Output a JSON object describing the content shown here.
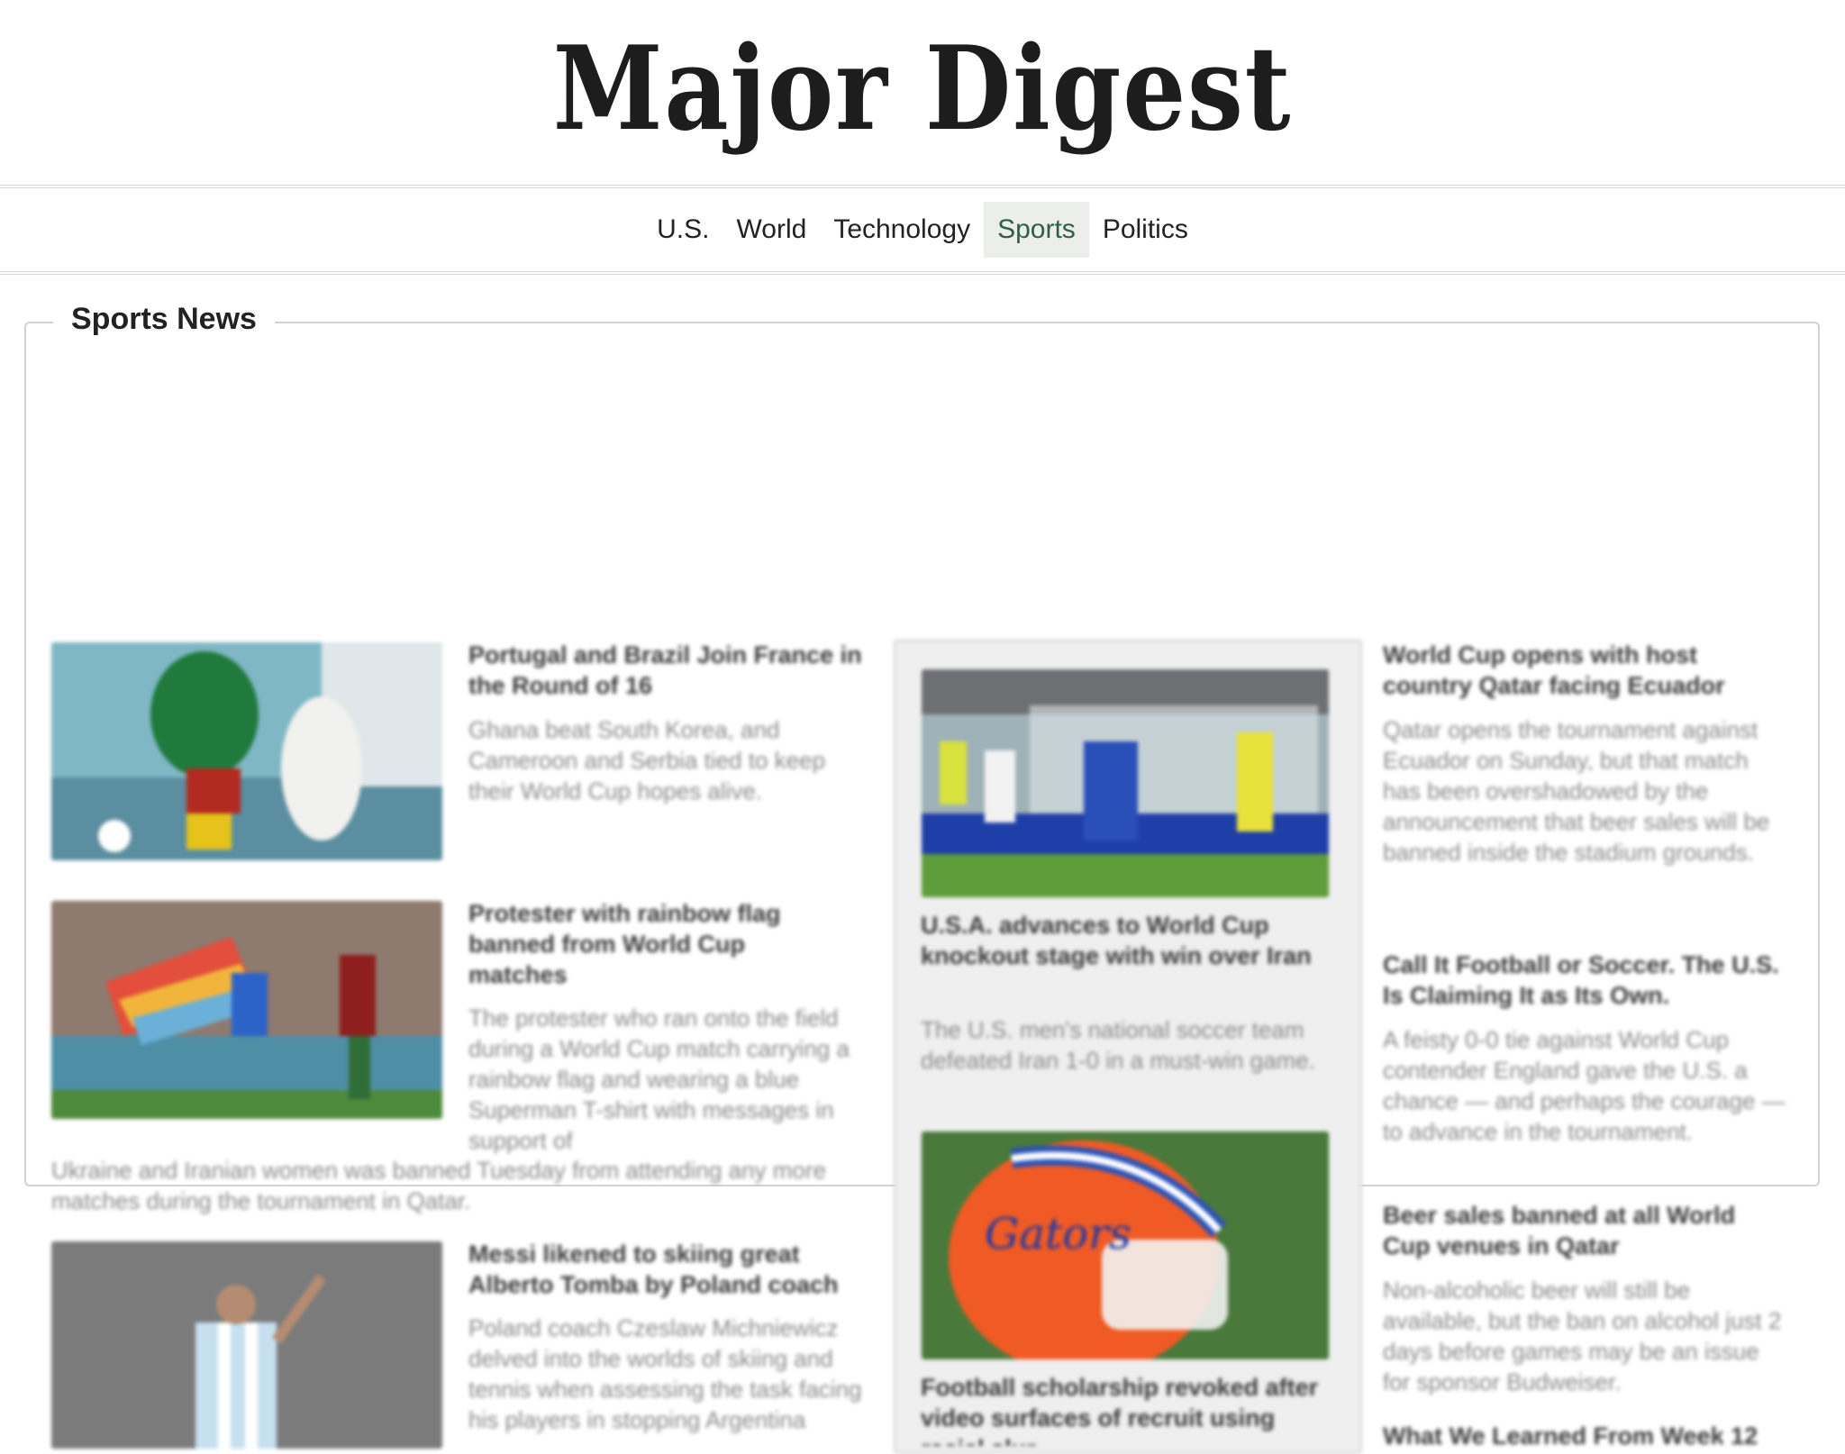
{
  "site": {
    "title": "Major Digest"
  },
  "nav": {
    "items": [
      {
        "label": "U.S."
      },
      {
        "label": "World"
      },
      {
        "label": "Technology"
      },
      {
        "label": "Sports"
      },
      {
        "label": "Politics"
      }
    ],
    "active": "Sports"
  },
  "section": {
    "title": "Sports News"
  },
  "left_column": [
    {
      "headline": "Portugal and Brazil Join France in the Round of 16",
      "summary": "Ghana beat South Korea, and Cameroon and Serbia tied to keep their World Cup hopes alive."
    },
    {
      "headline": "Protester with rainbow flag banned from World Cup matches",
      "summary": "The protester who ran onto the field during a World Cup match carrying a rainbow flag and wearing a blue Superman T-shirt with messages in support of Ukraine and Iranian women was banned Tuesday from attending any more matches during the tournament in Qatar."
    },
    {
      "headline": "Messi likened to skiing great Alberto Tomba by Poland coach",
      "summary": "Poland coach Czeslaw Michniewicz delved into the worlds of skiing and tennis when assessing the task facing his players in stopping Argentina"
    }
  ],
  "featured": [
    {
      "headline": "U.S.A. advances to World Cup knockout stage with win over Iran",
      "summary": "The U.S. men's national soccer team defeated Iran 1-0 in a must-win game."
    },
    {
      "headline": "Football scholarship revoked after video surfaces of recruit using racial slur"
    }
  ],
  "right_column": [
    {
      "headline": "World Cup opens with host country Qatar facing Ecuador",
      "summary": "Qatar opens the tournament against Ecuador on Sunday, but that match has been overshadowed by the announcement that beer sales will be banned inside the stadium grounds."
    },
    {
      "headline": "Call It Football or Soccer. The U.S. Is Claiming It as Its Own.",
      "summary": "A feisty 0-0 tie against World Cup contender England gave the U.S. a chance — and perhaps the courage — to advance in the tournament."
    },
    {
      "headline": "Beer sales banned at all World Cup venues in Qatar",
      "summary": "Non-alcoholic beer will still be available, but the ban on alcohol just 2 days before games may be an issue for sponsor Budweiser."
    },
    {
      "headline": "What We Learned From Week 12"
    }
  ]
}
